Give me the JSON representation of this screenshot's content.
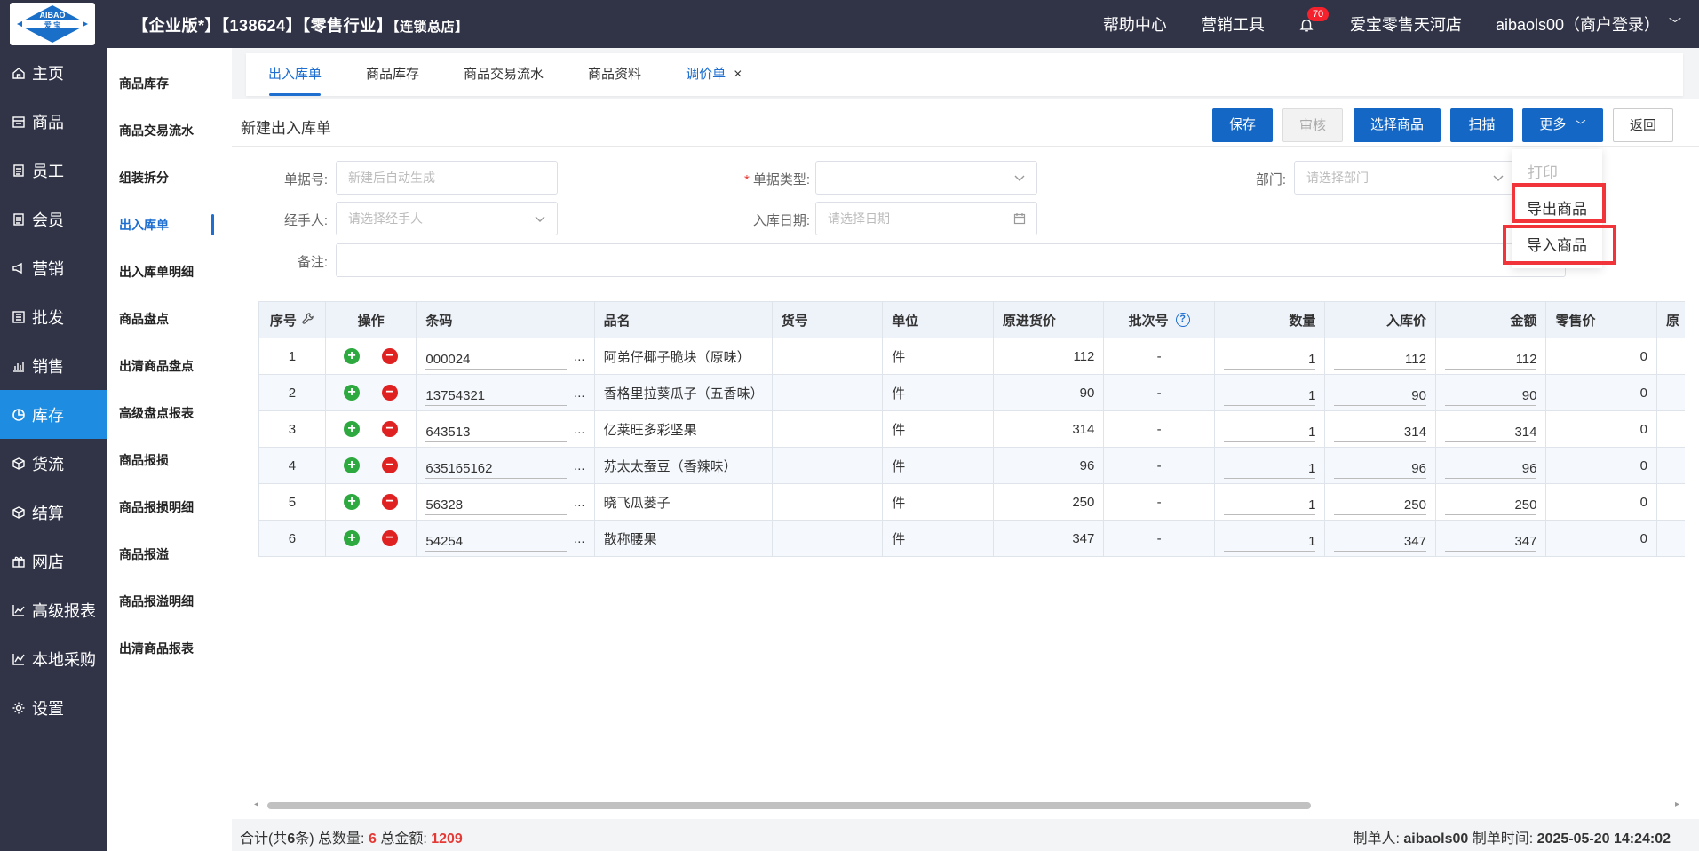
{
  "topbar": {
    "logo_top": "AIBAO",
    "logo_mid": "爱 宝",
    "crumb_main": "【企业版*】【138624】【零售行业】",
    "crumb_small": "【连锁总店】",
    "help": "帮助中心",
    "marketing": "营销工具",
    "badge": "70",
    "store": "爱宝零售天河店",
    "user": "aibaols00（商户登录）"
  },
  "nav": [
    {
      "label": "主页",
      "icon": "home-icon"
    },
    {
      "label": "商品",
      "icon": "goods-icon"
    },
    {
      "label": "员工",
      "icon": "staff-icon"
    },
    {
      "label": "会员",
      "icon": "member-icon"
    },
    {
      "label": "营销",
      "icon": "marketing-icon"
    },
    {
      "label": "批发",
      "icon": "wholesale-icon"
    },
    {
      "label": "销售",
      "icon": "sales-chart-icon"
    },
    {
      "label": "库存",
      "icon": "inventory-icon"
    },
    {
      "label": "货流",
      "icon": "logistics-icon"
    },
    {
      "label": "结算",
      "icon": "settlement-icon"
    },
    {
      "label": "网店",
      "icon": "gift-icon"
    },
    {
      "label": "高级报表",
      "icon": "report-line-icon"
    },
    {
      "label": "本地采购",
      "icon": "purchase-line-icon"
    },
    {
      "label": "设置",
      "icon": "gear-icon"
    }
  ],
  "subnav": [
    "商品库存",
    "商品交易流水",
    "组装拆分",
    "出入库单",
    "出入库单明细",
    "商品盘点",
    "出清商品盘点",
    "高级盘点报表",
    "商品报损",
    "商品报损明细",
    "商品报溢",
    "商品报溢明细",
    "出清商品报表"
  ],
  "tabs": [
    "出入库单",
    "商品库存",
    "商品交易流水",
    "商品资料",
    "调价单"
  ],
  "page": {
    "title": "新建出入库单",
    "buttons": {
      "save": "保存",
      "audit": "审核",
      "select": "选择商品",
      "scan": "扫描",
      "more": "更多",
      "back": "返回"
    }
  },
  "form": {
    "doc_no_label": "单据号:",
    "doc_no_placeholder": "新建后自动生成",
    "doc_type_label": "单据类型:",
    "dept_label": "部门:",
    "dept_placeholder": "请选择部门",
    "handler_label": "经手人:",
    "handler_placeholder": "请选择经手人",
    "date_label": "入库日期:",
    "date_placeholder": "请选择日期",
    "remark_label": "备注:"
  },
  "dropdown": {
    "print": "打印",
    "export": "导出商品",
    "import": "导入商品"
  },
  "table": {
    "headers": {
      "seq": "序号",
      "op": "操作",
      "barcode": "条码",
      "name": "品名",
      "sku": "货号",
      "unit": "单位",
      "cost": "原进货价",
      "batch": "批次号",
      "qty": "数量",
      "in_price": "入库价",
      "amount": "金额",
      "retail": "零售价",
      "more": "原"
    },
    "rows": [
      {
        "seq": "1",
        "barcode": "000024",
        "name": "阿弟仔椰子脆块（原味）",
        "unit": "件",
        "cost": "112",
        "batch": "-",
        "qty": "1",
        "in_price": "112",
        "amount": "112",
        "retail": "0"
      },
      {
        "seq": "2",
        "barcode": "13754321",
        "name": "香格里拉葵瓜子（五香味）",
        "unit": "件",
        "cost": "90",
        "batch": "-",
        "qty": "1",
        "in_price": "90",
        "amount": "90",
        "retail": "0"
      },
      {
        "seq": "3",
        "barcode": "643513",
        "name": "亿莱旺多彩坚果",
        "unit": "件",
        "cost": "314",
        "batch": "-",
        "qty": "1",
        "in_price": "314",
        "amount": "314",
        "retail": "0"
      },
      {
        "seq": "4",
        "barcode": "635165162",
        "name": "苏太太蚕豆（香辣味）",
        "unit": "件",
        "cost": "96",
        "batch": "-",
        "qty": "1",
        "in_price": "96",
        "amount": "96",
        "retail": "0"
      },
      {
        "seq": "5",
        "barcode": "56328",
        "name": "晓飞瓜蒌子",
        "unit": "件",
        "cost": "250",
        "batch": "-",
        "qty": "1",
        "in_price": "250",
        "amount": "250",
        "retail": "0"
      },
      {
        "seq": "6",
        "barcode": "54254",
        "name": "散称腰果",
        "unit": "件",
        "cost": "347",
        "batch": "-",
        "qty": "1",
        "in_price": "347",
        "amount": "347",
        "retail": "0"
      }
    ]
  },
  "footer": {
    "total_prefix": "合计(共",
    "count": "6",
    "total_suffix": "条)",
    "qty_label": "总数量:",
    "qty": "6",
    "amount_label": "总金额:",
    "amount": "1209",
    "maker_label": "制单人:",
    "maker": "aibaols00",
    "time_label": "制单时间:",
    "time": "2025-05-20 14:24:02"
  },
  "colors": {
    "sidebar": "#313447",
    "active": "#1e8ce0",
    "primary": "#1467c4",
    "highlight": "#f0343a"
  }
}
